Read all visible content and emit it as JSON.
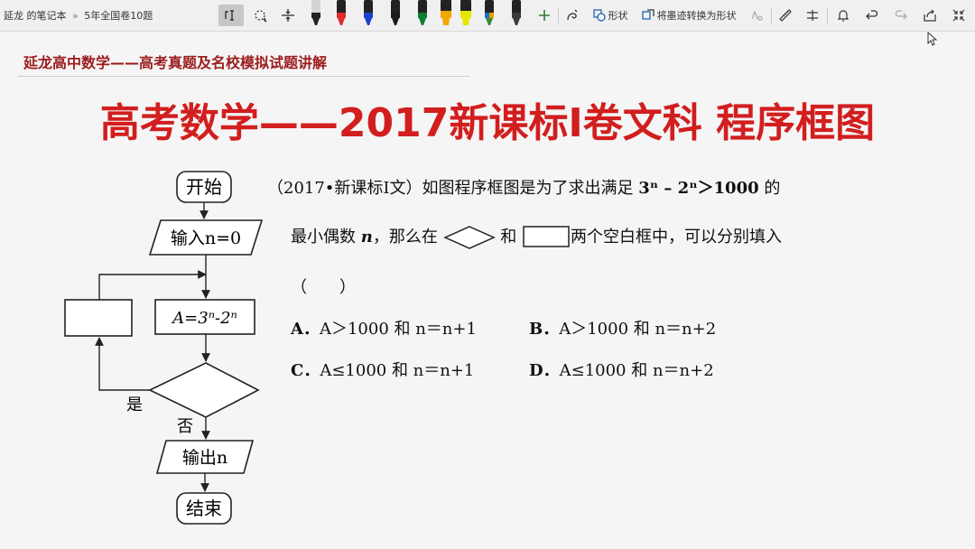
{
  "toolbar": {
    "breadcrumb_notebook": "延龙 的笔记本",
    "breadcrumb_sep": "»",
    "breadcrumb_page": "5年全国卷10题",
    "shape_label": "形状",
    "ink_to_shape_label": "将墨迹转换为形状",
    "pen_colors": [
      "#222222",
      "#e02b2b",
      "#1d3fd1",
      "#1b1b1b",
      "#0a7e2e",
      "#f2a600",
      "#e6e600",
      "#1b6ec2",
      "#3a3a3a"
    ]
  },
  "page": {
    "subtitle": "延龙高中数学——高考真题及名校模拟试题讲解",
    "title": "高考数学——2017新课标Ⅰ卷文科 程序框图"
  },
  "question": {
    "line1_prefix": "（2017•新课标Ⅰ文）如图程序框图是为了求出满足 ",
    "line1_expr": "3ⁿ – 2ⁿ＞1000",
    "line1_suffix": " 的",
    "line2_prefix": "最小偶数 ",
    "line2_var": "n",
    "line2_mid": "，那么在",
    "line2_and": "和",
    "line2_suffix": "两个空白框中，可以分别填入",
    "paren": "（　　）",
    "options": [
      {
        "label": "A．",
        "text": "A＞1000 和 n＝n+1"
      },
      {
        "label": "B．",
        "text": "A＞1000 和 n＝n+2"
      },
      {
        "label": "C．",
        "text": "A≤1000 和 n＝n+1"
      },
      {
        "label": "D．",
        "text": "A≤1000 和 n＝n+2"
      }
    ]
  },
  "flowchart": {
    "start": "开始",
    "input": "输入n=0",
    "process": "A=3ⁿ-2ⁿ",
    "yes": "是",
    "no": "否",
    "output": "输出n",
    "end": "结束"
  }
}
